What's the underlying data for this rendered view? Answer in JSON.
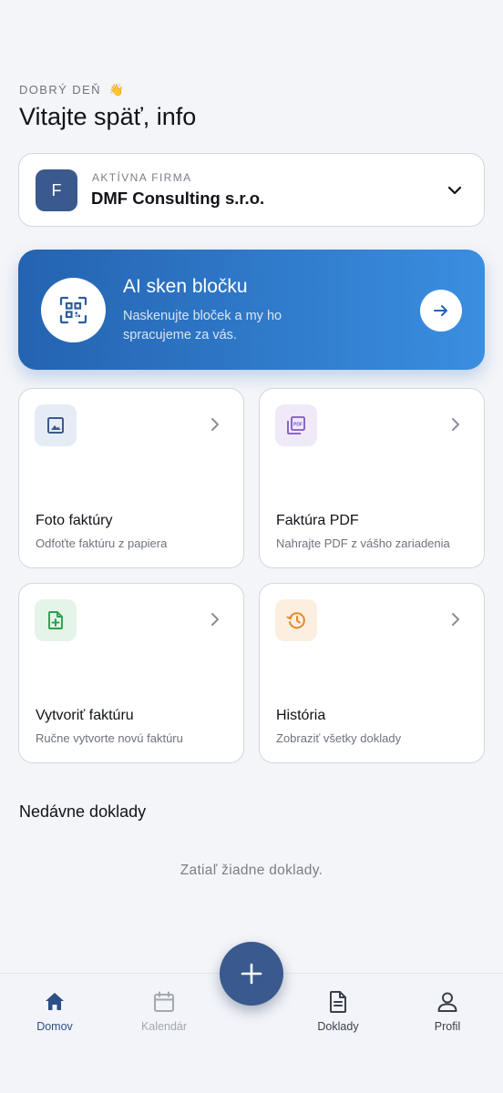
{
  "greeting": {
    "label": "DOBRÝ DEŇ",
    "emoji": "👋"
  },
  "title": "Vitajte späť, info",
  "company": {
    "avatar": "F",
    "label": "AKTÍVNA FIRMA",
    "name": "DMF Consulting s.r.o.",
    "icon": "chevron-down-icon"
  },
  "ai_scan": {
    "title": "AI sken bločku",
    "description": "Naskenujte bloček a my ho spracujeme za vás.",
    "icon": "qr-scan-icon",
    "action_icon": "arrow-right-icon"
  },
  "tiles": [
    {
      "title": "Foto faktúry",
      "subtitle": "Odfoťte faktúru z papiera",
      "icon": "image-icon",
      "color": "#3a5a8e",
      "bg": "#e6ecf6"
    },
    {
      "title": "Faktúra PDF",
      "subtitle": "Nahrajte PDF z vášho zariadenia",
      "icon": "pdf-icon",
      "color": "#7e57c2",
      "bg": "#efe9f8"
    },
    {
      "title": "Vytvoriť faktúru",
      "subtitle": "Ručne vytvorte novú faktúru",
      "icon": "file-add-icon",
      "color": "#2e9d4e",
      "bg": "#e4f4e8"
    },
    {
      "title": "História",
      "subtitle": "Zobraziť všetky doklady",
      "icon": "history-icon",
      "color": "#e58a2b",
      "bg": "#fcefdf"
    }
  ],
  "recent": {
    "title": "Nedávne doklady",
    "empty": "Zatiaľ žiadne doklady."
  },
  "nav": [
    {
      "label": "Domov",
      "icon": "home-icon",
      "state": "active"
    },
    {
      "label": "Kalendár",
      "icon": "calendar-icon",
      "state": "disabled"
    },
    {
      "label": "Doklady",
      "icon": "document-icon",
      "state": "normal"
    },
    {
      "label": "Profil",
      "icon": "user-icon",
      "state": "normal"
    }
  ],
  "fab": {
    "icon": "plus-icon"
  },
  "colors": {
    "primary": "#3a5a8e",
    "accent_gradient_start": "#2463b0",
    "accent_gradient_end": "#3a8ee0",
    "background": "#f4f5f9"
  }
}
